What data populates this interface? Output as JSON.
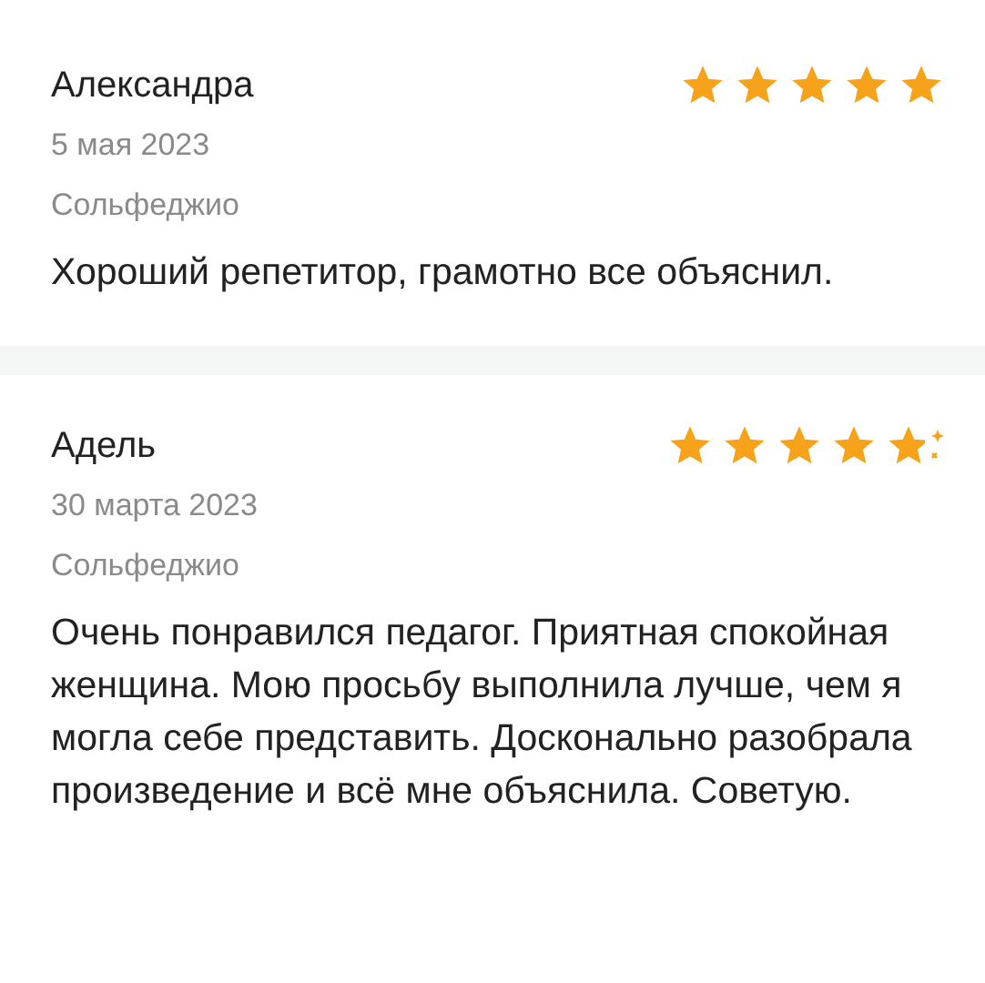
{
  "reviews": [
    {
      "author": "Александра",
      "stars": 5,
      "date": "5 мая 2023",
      "subject": "Сольфеджио",
      "text": "Хороший репетитор, грамотно все объяснил."
    },
    {
      "author": "Адель",
      "stars": 5,
      "sparkle": true,
      "date": "30 марта 2023",
      "subject": "Сольфеджио",
      "text": "Очень понравился педагог. Приятная спокойная женщина. Мою просьбу выполнила лучше, чем я могла себе представить. Досконально разобрала произведение и всё мне объяснила. Советую."
    }
  ]
}
